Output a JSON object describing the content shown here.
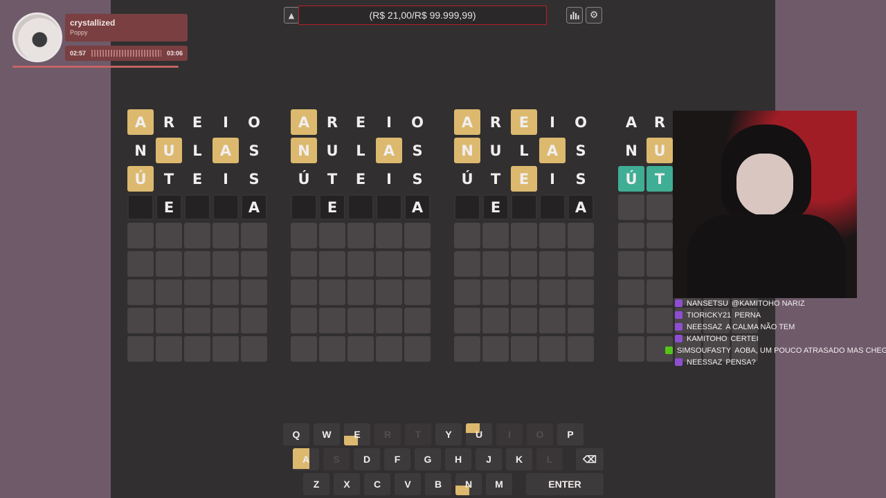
{
  "topbar": {
    "range_text": "(R$ 21,00/R$ 99.999,99)",
    "collapse_icon": "chevron-up-icon",
    "stats_icon": "bar-chart-icon",
    "settings_icon": "gear-icon"
  },
  "boards": [
    {
      "rows": [
        [
          {
            "l": "A",
            "s": "yellow"
          },
          {
            "l": "R",
            "s": "plain"
          },
          {
            "l": "E",
            "s": "plain"
          },
          {
            "l": "I",
            "s": "plain"
          },
          {
            "l": "O",
            "s": "plain"
          }
        ],
        [
          {
            "l": "N",
            "s": "plain"
          },
          {
            "l": "U",
            "s": "yellow"
          },
          {
            "l": "L",
            "s": "plain"
          },
          {
            "l": "A",
            "s": "yellow"
          },
          {
            "l": "S",
            "s": "plain"
          }
        ],
        [
          {
            "l": "Ú",
            "s": "yellow"
          },
          {
            "l": "T",
            "s": "plain"
          },
          {
            "l": "E",
            "s": "plain"
          },
          {
            "l": "I",
            "s": "plain"
          },
          {
            "l": "S",
            "s": "plain"
          }
        ],
        [
          {
            "l": "",
            "s": "empty"
          },
          {
            "l": "E",
            "s": "empty"
          },
          {
            "l": "",
            "s": "empty"
          },
          {
            "l": "",
            "s": "empty"
          },
          {
            "l": "A",
            "s": "empty"
          }
        ]
      ]
    },
    {
      "rows": [
        [
          {
            "l": "A",
            "s": "yellow"
          },
          {
            "l": "R",
            "s": "plain"
          },
          {
            "l": "E",
            "s": "plain"
          },
          {
            "l": "I",
            "s": "plain"
          },
          {
            "l": "O",
            "s": "plain"
          }
        ],
        [
          {
            "l": "N",
            "s": "yellow"
          },
          {
            "l": "U",
            "s": "plain"
          },
          {
            "l": "L",
            "s": "plain"
          },
          {
            "l": "A",
            "s": "yellow"
          },
          {
            "l": "S",
            "s": "plain"
          }
        ],
        [
          {
            "l": "Ú",
            "s": "plain"
          },
          {
            "l": "T",
            "s": "plain"
          },
          {
            "l": "E",
            "s": "plain"
          },
          {
            "l": "I",
            "s": "plain"
          },
          {
            "l": "S",
            "s": "plain"
          }
        ],
        [
          {
            "l": "",
            "s": "empty"
          },
          {
            "l": "E",
            "s": "empty"
          },
          {
            "l": "",
            "s": "empty"
          },
          {
            "l": "",
            "s": "empty"
          },
          {
            "l": "A",
            "s": "empty"
          }
        ]
      ]
    },
    {
      "rows": [
        [
          {
            "l": "A",
            "s": "yellow"
          },
          {
            "l": "R",
            "s": "plain"
          },
          {
            "l": "E",
            "s": "yellow"
          },
          {
            "l": "I",
            "s": "plain"
          },
          {
            "l": "O",
            "s": "plain"
          }
        ],
        [
          {
            "l": "N",
            "s": "yellow"
          },
          {
            "l": "U",
            "s": "plain"
          },
          {
            "l": "L",
            "s": "plain"
          },
          {
            "l": "A",
            "s": "yellow"
          },
          {
            "l": "S",
            "s": "plain"
          }
        ],
        [
          {
            "l": "Ú",
            "s": "plain"
          },
          {
            "l": "T",
            "s": "plain"
          },
          {
            "l": "E",
            "s": "yellow"
          },
          {
            "l": "I",
            "s": "plain"
          },
          {
            "l": "S",
            "s": "plain"
          }
        ],
        [
          {
            "l": "",
            "s": "empty"
          },
          {
            "l": "E",
            "s": "empty"
          },
          {
            "l": "",
            "s": "empty"
          },
          {
            "l": "",
            "s": "empty"
          },
          {
            "l": "A",
            "s": "empty"
          }
        ]
      ]
    },
    {
      "rows": [
        [
          {
            "l": "A",
            "s": "plain"
          },
          {
            "l": "R",
            "s": "plain"
          },
          {
            "l": "",
            "s": "plain"
          },
          {
            "l": "",
            "s": "plain"
          },
          {
            "l": "",
            "s": "plain"
          }
        ],
        [
          {
            "l": "N",
            "s": "plain"
          },
          {
            "l": "U",
            "s": "yellow"
          },
          {
            "l": "",
            "s": "plain"
          },
          {
            "l": "",
            "s": "plain"
          },
          {
            "l": "",
            "s": "plain"
          }
        ],
        [
          {
            "l": "Ú",
            "s": "green"
          },
          {
            "l": "T",
            "s": "green"
          },
          {
            "l": "",
            "s": "plain"
          },
          {
            "l": "",
            "s": "plain"
          },
          {
            "l": "",
            "s": "plain"
          }
        ],
        [
          {
            "l": "",
            "s": "blank"
          },
          {
            "l": "",
            "s": "blank"
          },
          {
            "l": "",
            "s": "blank"
          },
          {
            "l": "",
            "s": "blank"
          },
          {
            "l": "",
            "s": "blank"
          }
        ]
      ]
    }
  ],
  "keyboard": {
    "row1": [
      {
        "k": "Q",
        "st": "normal"
      },
      {
        "k": "W",
        "st": "normal"
      },
      {
        "k": "E",
        "st": "hint-bl"
      },
      {
        "k": "R",
        "st": "disabled"
      },
      {
        "k": "T",
        "st": "disabled"
      },
      {
        "k": "Y",
        "st": "normal"
      },
      {
        "k": "U",
        "st": "hint-tl"
      },
      {
        "k": "I",
        "st": "disabled"
      },
      {
        "k": "O",
        "st": "disabled"
      },
      {
        "k": "P",
        "st": "normal"
      }
    ],
    "row2": [
      {
        "k": "A",
        "st": "hint-full"
      },
      {
        "k": "S",
        "st": "disabled"
      },
      {
        "k": "D",
        "st": "normal"
      },
      {
        "k": "F",
        "st": "normal"
      },
      {
        "k": "G",
        "st": "normal"
      },
      {
        "k": "H",
        "st": "normal"
      },
      {
        "k": "J",
        "st": "normal"
      },
      {
        "k": "K",
        "st": "normal"
      },
      {
        "k": "L",
        "st": "disabled"
      }
    ],
    "backspace_symbol": "⌫",
    "row3": [
      {
        "k": "Z",
        "st": "normal"
      },
      {
        "k": "X",
        "st": "normal"
      },
      {
        "k": "C",
        "st": "normal"
      },
      {
        "k": "V",
        "st": "normal"
      },
      {
        "k": "B",
        "st": "normal"
      },
      {
        "k": "N",
        "st": "hint-bl"
      },
      {
        "k": "M",
        "st": "normal"
      }
    ],
    "enter_label": "ENTER"
  },
  "music": {
    "title": "crystallized",
    "artist": "Poppy",
    "elapsed": "02:57",
    "duration": "03:06"
  },
  "chat": [
    {
      "user": "NANSETSU",
      "msg": "@KAMITOHO NARIZ",
      "badge": "purple"
    },
    {
      "user": "TIORICKY21",
      "msg": "PERNA",
      "badge": "purple"
    },
    {
      "user": "NEESSAZ",
      "msg": "A CALMA NÃO TEM",
      "badge": "purple"
    },
    {
      "user": "KAMITOHO",
      "msg": "CERTEI",
      "badge": "purple"
    },
    {
      "user": "SIMSOUFASTY",
      "msg": "AOBA, UM POUCO ATRASADO MAS CHEGUEI",
      "badge": "green"
    },
    {
      "user": "NEESSAZ",
      "msg": "PENSA?",
      "badge": "purple"
    }
  ]
}
